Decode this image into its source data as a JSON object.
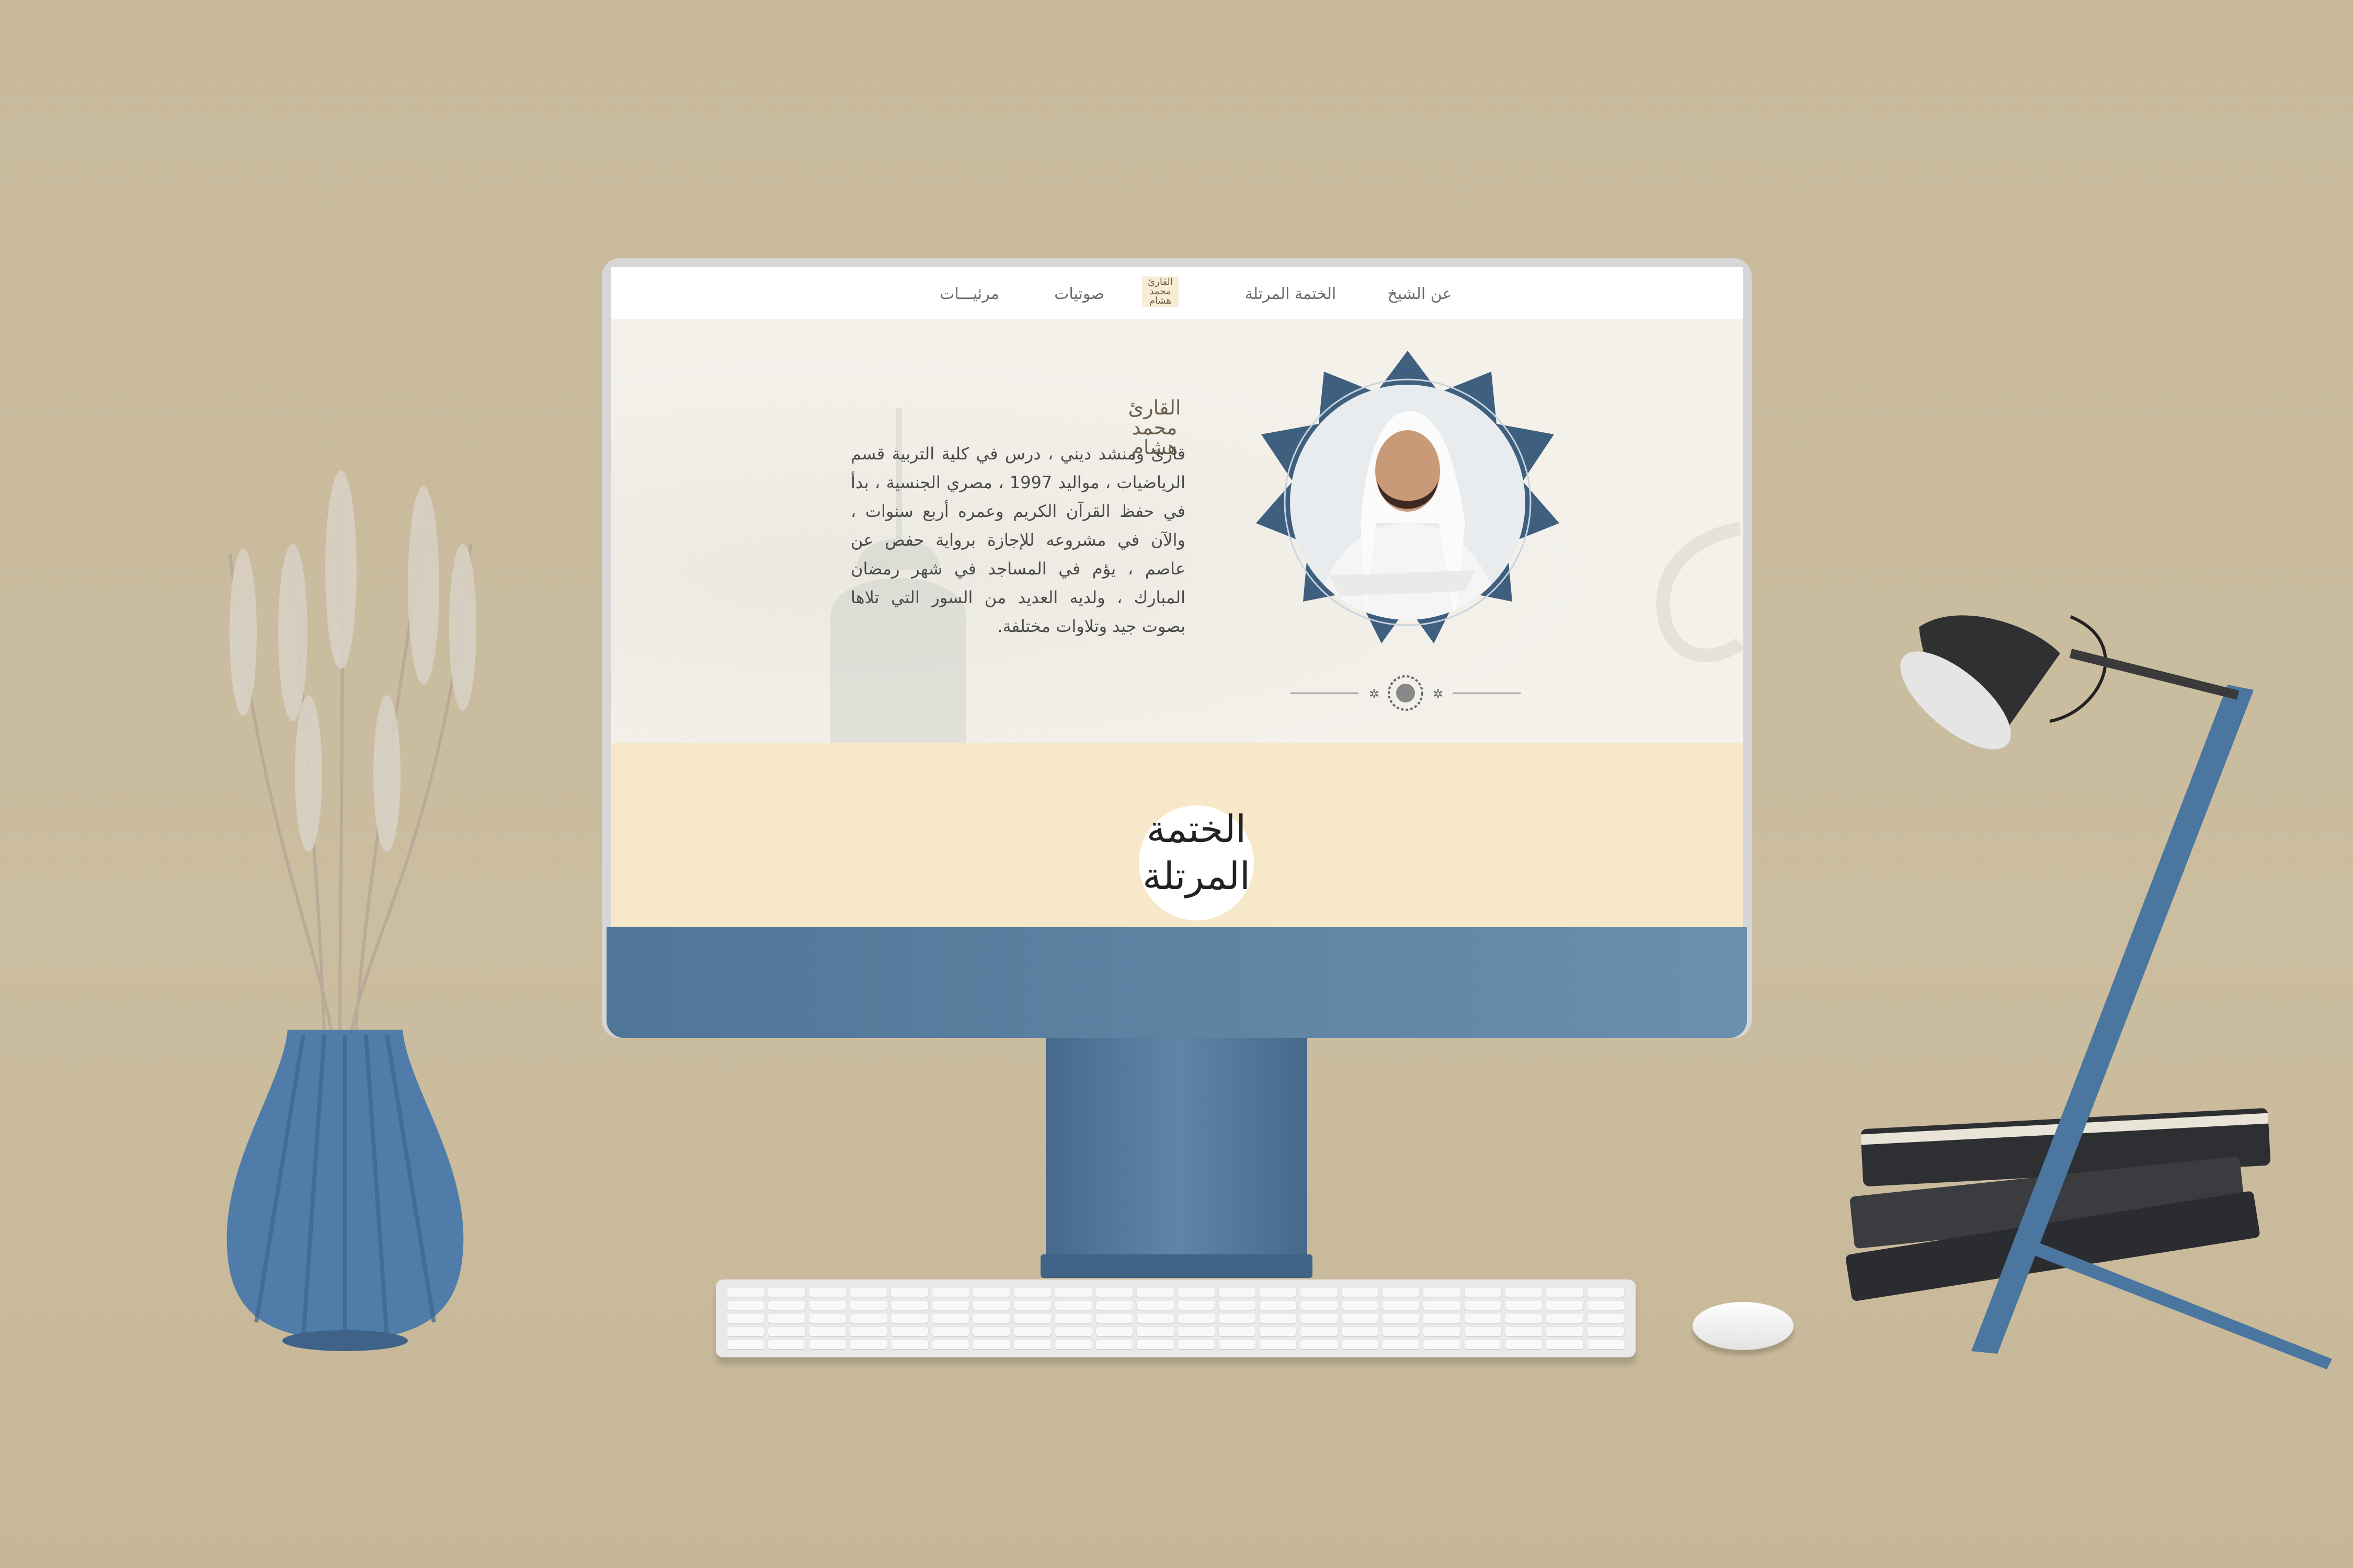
{
  "nav": {
    "items": [
      {
        "label": "عن الشيخ"
      },
      {
        "label": "الختمة المرتلة"
      },
      {
        "label": "صوتيات"
      },
      {
        "label": "مرئيـــات"
      }
    ],
    "logo_text": "القارئ محمد هشام"
  },
  "hero": {
    "logo_lines": [
      "القارئ",
      "محمد",
      "هشام"
    ],
    "bio": "قارئ ومنشد ديني ، درس في كلية التربية قسم الرياضيات ، مواليد 1997 ، مصري الجنسية ، بدأ في حفظ القرآن الكريم وعمره أربع سنوات ، والآن في مشروعه للإجازة برواية حفص عن عاصم ، يؤم في المساجد في شهر رمضان المبارك ، ولديه العديد من السور التي تلاها بصوت جيد وتلاوات مختلفة."
  },
  "section": {
    "heading_lines": [
      "الختمة",
      "المرتلة"
    ]
  },
  "colors": {
    "accent": "#3f5f7f",
    "monitor": "#5a80a2",
    "cream": "#f6e8c8",
    "background": "#c8b99b"
  }
}
